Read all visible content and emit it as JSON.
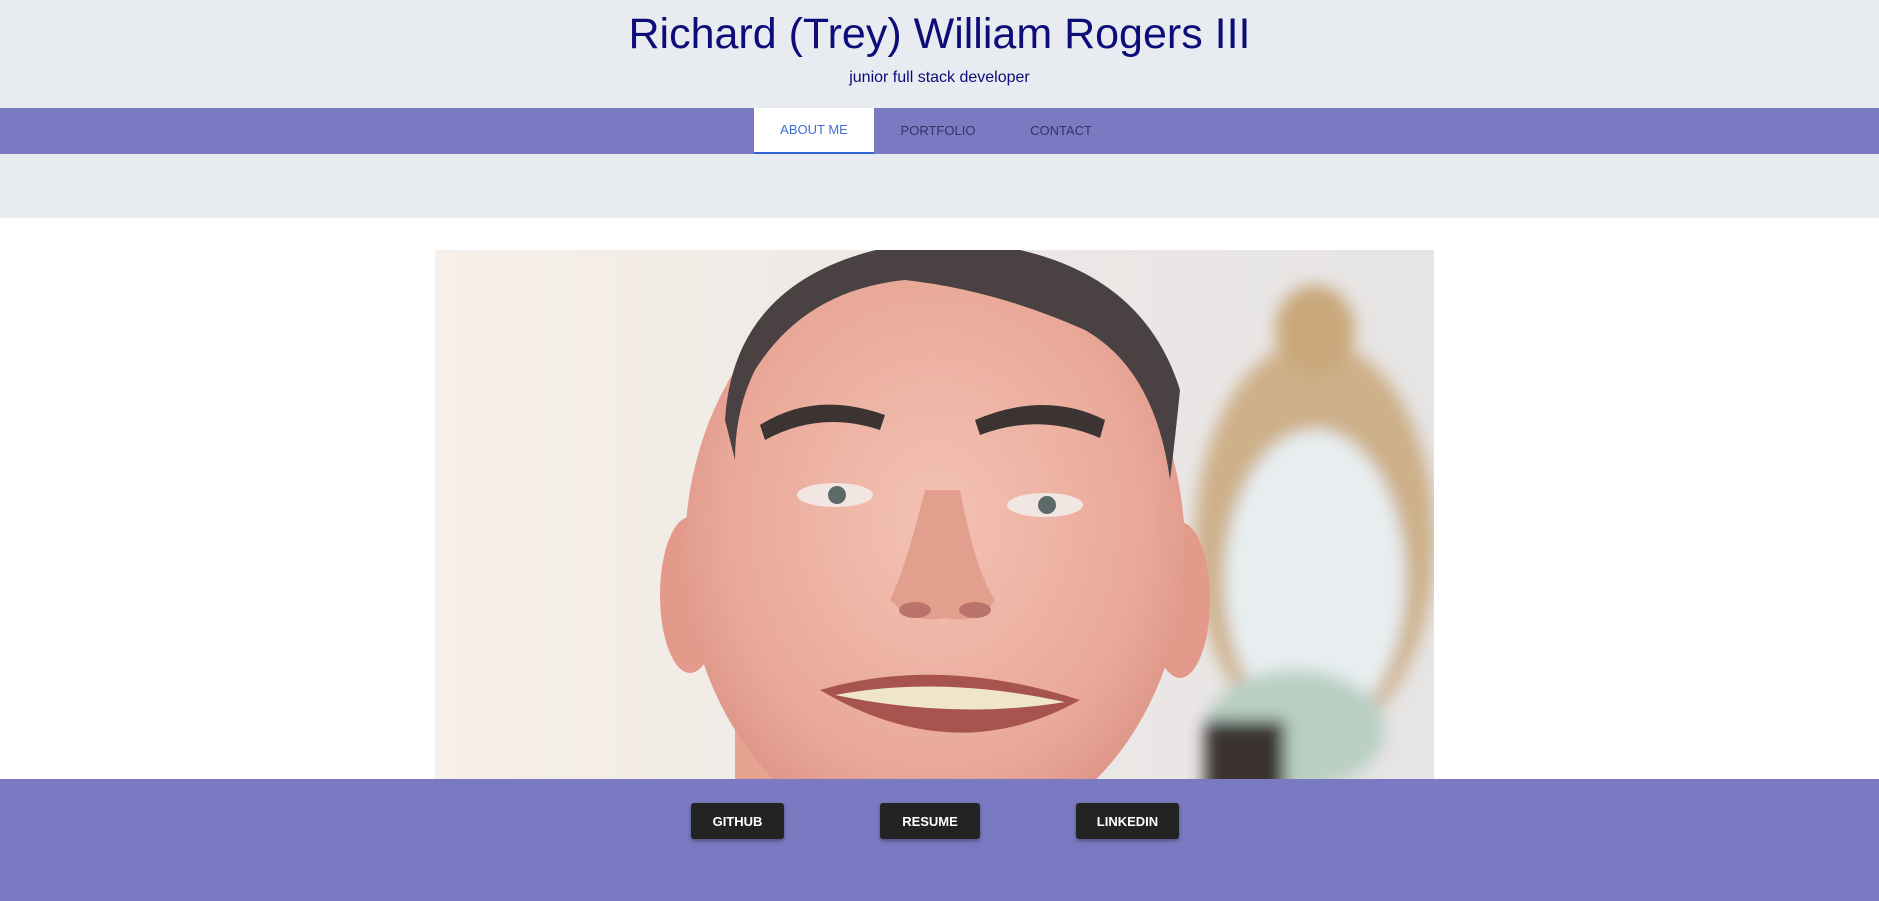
{
  "header": {
    "title": "Richard (Trey) William Rogers III",
    "subtitle": "junior full stack developer"
  },
  "nav": {
    "tabs": [
      {
        "label": "ABOUT ME",
        "active": true
      },
      {
        "label": "PORTFOLIO",
        "active": false
      },
      {
        "label": "CONTACT",
        "active": false
      }
    ]
  },
  "photo": {
    "subject": "portrait-photo"
  },
  "footer": {
    "buttons": [
      {
        "label": "GITHUB"
      },
      {
        "label": "RESUME"
      },
      {
        "label": "LINKEDIN"
      }
    ]
  },
  "colors": {
    "header_bg": "#e8ebef",
    "nav_bg": "#7a7ac2",
    "title_color": "#0d0d7a",
    "active_tab_color": "#3f6ed1",
    "button_bg": "#232323"
  }
}
